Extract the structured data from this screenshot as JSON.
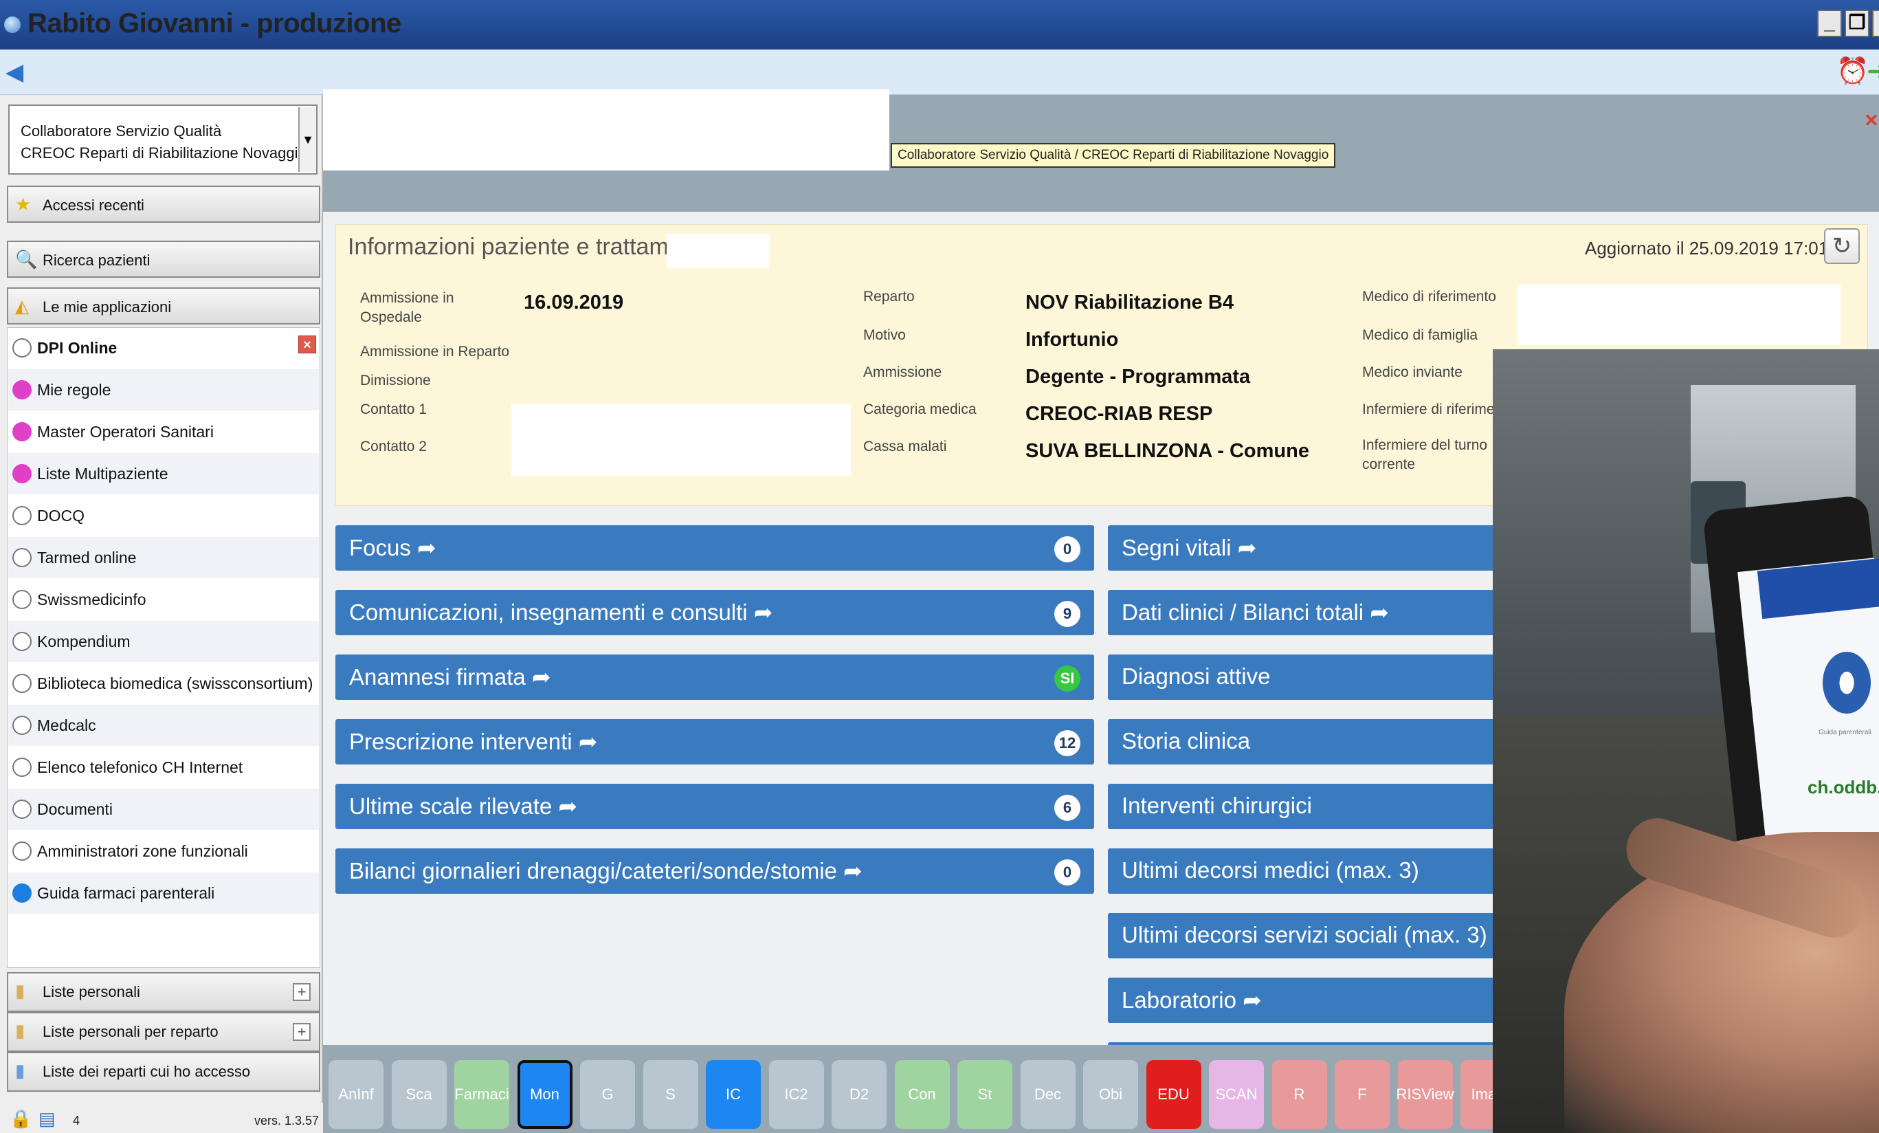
{
  "window": {
    "title": "Rabito Giovanni - produzione"
  },
  "role": {
    "line1": "Collaboratore Servizio Qualità",
    "line2": "CREOC Reparti di Riabilitazione Novaggio",
    "tooltip": "Collaboratore Servizio Qualità / CREOC Reparti di Riabilitazione Novaggio"
  },
  "sidebar": {
    "recent": "Accessi recenti",
    "search": "Ricerca pazienti",
    "apps_header": "Le mie applicazioni",
    "apps": [
      {
        "label": "DPI Online",
        "color": "#ffffff"
      },
      {
        "label": "Mie regole",
        "color": "#e040c8"
      },
      {
        "label": "Master Operatori Sanitari",
        "color": "#e040c8"
      },
      {
        "label": "Liste Multipaziente",
        "color": "#e040c8"
      },
      {
        "label": "DOCQ",
        "color": "#ffffff"
      },
      {
        "label": "Tarmed online",
        "color": "#ffffff"
      },
      {
        "label": "Swissmedicinfo",
        "color": "#ffffff"
      },
      {
        "label": "Kompendium",
        "color": "#ffffff"
      },
      {
        "label": "Biblioteca biomedica (swissconsortium)",
        "color": "#ffffff"
      },
      {
        "label": "Medcalc",
        "color": "#ffffff"
      },
      {
        "label": "Elenco telefonico CH Internet",
        "color": "#ffffff"
      },
      {
        "label": "Documenti",
        "color": "#ffffff"
      },
      {
        "label": "Amministratori zone funzionali",
        "color": "#ffffff"
      },
      {
        "label": "Guida farmaci parenterali",
        "color": "#1e7ee0"
      }
    ],
    "personal_lists": "Liste personali",
    "personal_lists_dept": "Liste personali per reparto",
    "dept_lists": "Liste dei reparti cui ho accesso",
    "status_count": "4",
    "version": "vers. 1.3.57"
  },
  "info": {
    "title": "Informazioni paziente e trattamento",
    "updated": "Aggiornato il 25.09.2019 17:01",
    "col1_labels": [
      "Ammissione in Ospedale",
      "Ammissione in Reparto",
      "Dimissione",
      "Contatto 1",
      "Contatto 2"
    ],
    "admission_date": "16.09.2019",
    "col2_labels": [
      "Reparto",
      "Motivo",
      "Ammissione",
      "Categoria medica",
      "Cassa malati"
    ],
    "col2_values": [
      "NOV Riabilitazione B4",
      "Infortunio",
      "Degente - Programmata",
      "CREOC-RIAB RESP",
      "SUVA BELLINZONA - Comune"
    ],
    "col3_labels": [
      "Medico di riferimento",
      "Medico di famiglia",
      "Medico inviante",
      "Infermiere di riferime",
      "Infermiere del turno corrente (pomeriggio"
    ]
  },
  "left_bars": [
    {
      "label": "Focus ➦",
      "badge": "0"
    },
    {
      "label": "Comunicazioni, insegnamenti e consulti ➦",
      "badge": "9"
    },
    {
      "label": "Anamnesi firmata ➦",
      "badge": "SI"
    },
    {
      "label": "Prescrizione interventi ➦",
      "badge": "12"
    },
    {
      "label": "Ultime scale rilevate ➦",
      "badge": "6"
    },
    {
      "label": "Bilanci giornalieri drenaggi/cateteri/sonde/stomie ➦",
      "badge": "0"
    }
  ],
  "right_bars": [
    "Segni vitali ➦",
    "Dati clinici / Bilanci totali ➦",
    "Diagnosi attive",
    "Storia clinica",
    "Interventi chirurgici",
    "Ultimi decorsi medici (max. 3)",
    "Ultimi decorsi servizi sociali (max. 3)",
    "Laboratorio ➦"
  ],
  "tabs": [
    {
      "label": "AnInf",
      "color": "#b9c6d0"
    },
    {
      "label": "Sca",
      "color": "#b9c6d0"
    },
    {
      "label": "Farmaci",
      "color": "#9fd39f"
    },
    {
      "label": "Mon",
      "color": "#1e86f0"
    },
    {
      "label": "G",
      "color": "#b9c6d0"
    },
    {
      "label": "S",
      "color": "#b9c6d0"
    },
    {
      "label": "IC",
      "color": "#1e86f0"
    },
    {
      "label": "IC2",
      "color": "#b9c6d0"
    },
    {
      "label": "D2",
      "color": "#b9c6d0"
    },
    {
      "label": "Con",
      "color": "#9fd39f"
    },
    {
      "label": "St",
      "color": "#9fd39f"
    },
    {
      "label": "Dec",
      "color": "#b9c6d0"
    },
    {
      "label": "Obi",
      "color": "#b9c6d0"
    },
    {
      "label": "EDU",
      "color": "#e01e1e"
    },
    {
      "label": "SCAN",
      "color": "#e6b6e6"
    },
    {
      "label": "R",
      "color": "#e89a9a"
    },
    {
      "label": "F",
      "color": "#e89a9a"
    },
    {
      "label": "RISView",
      "color": "#e89a9a"
    },
    {
      "label": "Imag",
      "color": "#e89a9a"
    }
  ],
  "photo": {
    "tablet_caption": "Guida parenterali",
    "tablet_logo": "ch.oddb.org"
  },
  "icons": {
    "back": "back-arrow-icon",
    "alarm": "alarm-clock-icon",
    "exit": "exit-icon",
    "refresh": "refresh-icon"
  }
}
